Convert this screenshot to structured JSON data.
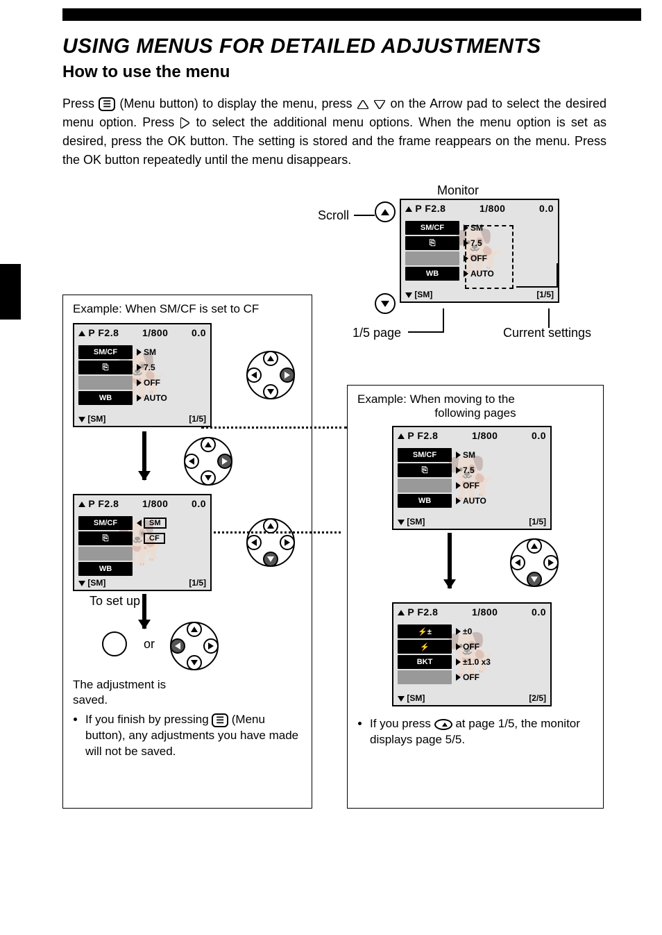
{
  "title": "USING MENUS FOR DETAILED ADJUSTMENTS",
  "subtitle": "How to use the menu",
  "paragraph_parts": {
    "p1": "Press ",
    "p2": " (Menu button) to display the menu, press ",
    "p3": " on the Arrow pad to select the desired menu option. Press ",
    "p4": " to select the additional menu options. When the menu option is set as desired, press the OK button. The setting is stored and the frame reappears on the menu. Press the OK button repeatedly until the menu disappears."
  },
  "labels": {
    "scroll": "Scroll",
    "monitor": "Monitor",
    "page_frac": "1/5 page",
    "current_settings": "Current settings",
    "example_left": "Example:   When SM/CF is set to CF",
    "example_right_l1": "Example:   When moving to the",
    "example_right_l2": "following pages",
    "to_set_up": "To set up",
    "or": "or",
    "adjustment_saved": "The adjustment is saved."
  },
  "notes": {
    "left": "If you finish by pressing       (Menu button), any adjustments you have made will not be saved.",
    "right_a": "If you press ",
    "right_b": " at page 1/5, the monitor displays page 5/5."
  },
  "menu_common": {
    "top": {
      "mode": "P",
      "aperture": "F2.8",
      "shutter": "1/800",
      "ev": "0.0"
    },
    "card": "[SM]"
  },
  "menu_rows_p1": [
    {
      "label": "SM/CF",
      "value": "SM"
    },
    {
      "label_icon": "drive",
      "value": "7.5"
    },
    {
      "label": "",
      "value": "OFF"
    },
    {
      "label": "WB",
      "value": "AUTO"
    }
  ],
  "menu_rows_p1_15": "[1/5]",
  "menu_select": {
    "rows": [
      {
        "label": "SM/CF",
        "options": [
          "SM",
          "CF"
        ],
        "selected": "SM"
      },
      {
        "label_icon": "drive"
      },
      {
        "label": ""
      },
      {
        "label": "WB"
      }
    ],
    "page": "[1/5]"
  },
  "menu_p2": {
    "rows": [
      {
        "label_icon": "flashcomp",
        "value": "±0"
      },
      {
        "label_icon": "flash",
        "value": "OFF"
      },
      {
        "label": "BKT",
        "value": "±1.0 x3"
      },
      {
        "label": "",
        "value": "OFF"
      }
    ],
    "page": "[2/5]"
  }
}
